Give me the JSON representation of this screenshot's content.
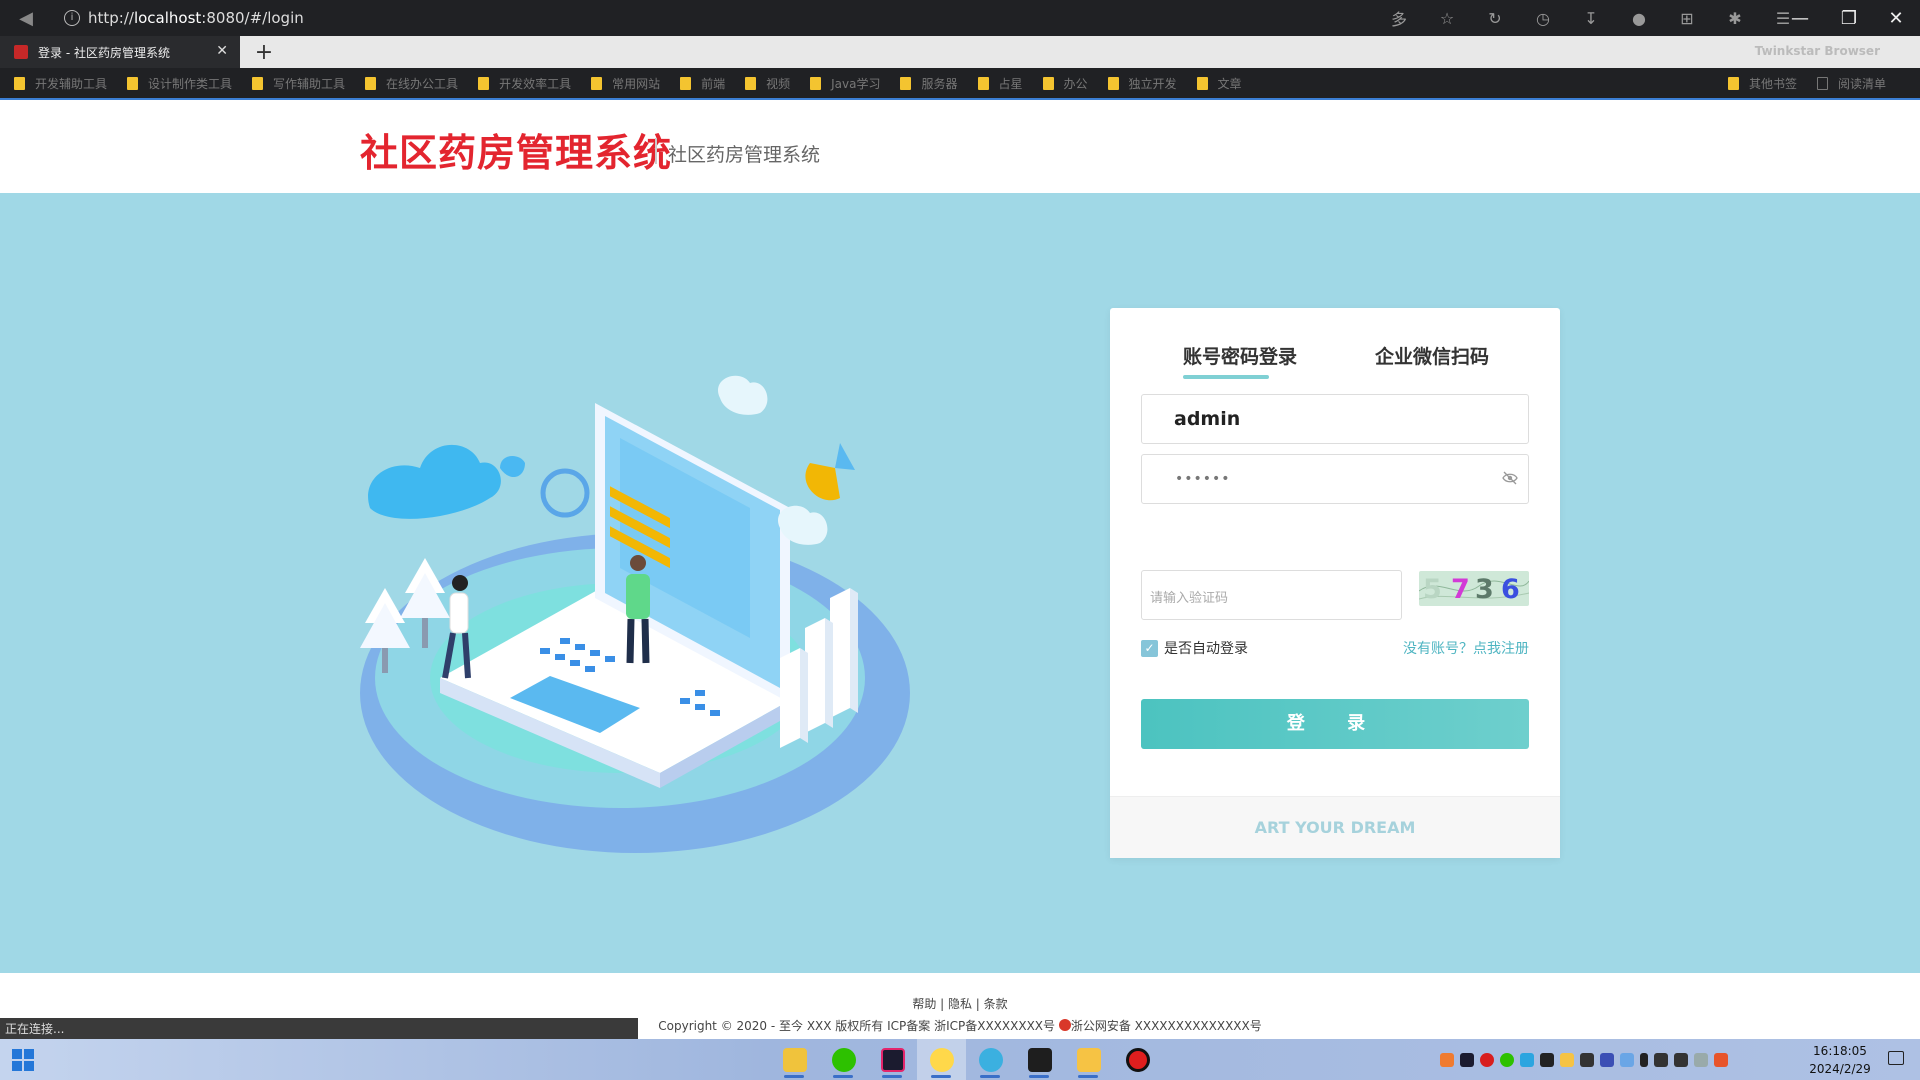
{
  "browser": {
    "url_prefix": "http://",
    "url_host": "localhost",
    "url_rest": ":8080/#/login",
    "tab_title": "登录 - 社区药房管理系统",
    "brand": "Twinkstar Browser",
    "bookmarks": [
      "开发辅助工具",
      "设计制作类工具",
      "写作辅助工具",
      "在线办公工具",
      "开发效率工具",
      "常用网站",
      "前端",
      "视频",
      "Java学习",
      "服务器",
      "占星",
      "办公",
      "独立开发",
      "文章"
    ],
    "bookmarks_right": [
      "其他书签",
      "阅读清单"
    ],
    "status": "正在连接..."
  },
  "header": {
    "logo_title": "社区药房管理系统",
    "logo_subtitle": "社区药房管理系统"
  },
  "login": {
    "tab_password": "账号密码登录",
    "tab_wechat": "企业微信扫码",
    "username_value": "admin",
    "password_mask": "••••••",
    "captcha_placeholder": "请输入验证码",
    "captcha_chars": [
      "5",
      "7",
      "3",
      "6"
    ],
    "remember_label": "是否自动登录",
    "register_link": "没有账号？点我注册",
    "login_button": "登 录",
    "footer_slogan": "ART YOUR DREAM"
  },
  "footer": {
    "links": "帮助 | 隐私 | 条款",
    "copyright_a": "Copyright © 2020 - 至今 XXX 版权所有 ICP备案 浙ICP备XXXXXXXX号 ",
    "copyright_b": "浙公网安备 XXXXXXXXXXXXXX号"
  },
  "taskbar": {
    "time": "16:18:05",
    "date": "2024/2/29"
  }
}
